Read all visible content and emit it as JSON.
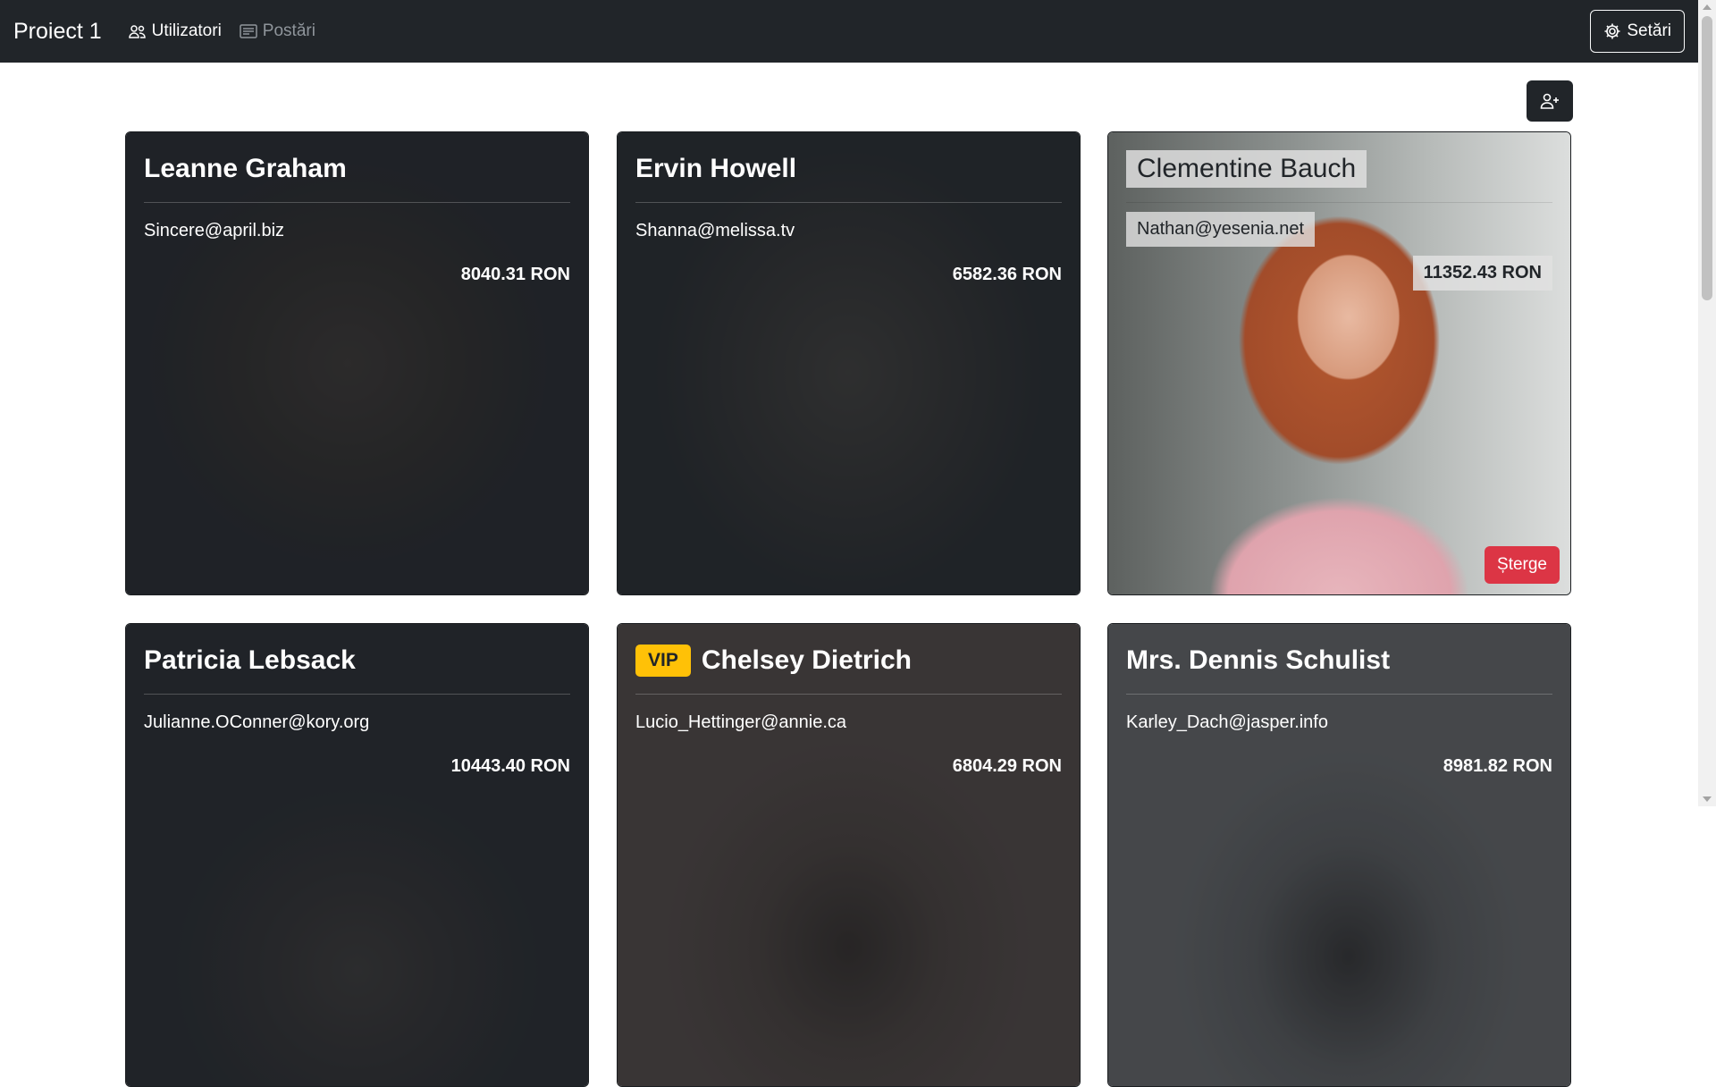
{
  "navbar": {
    "brand": "Proiect 1",
    "links": [
      {
        "label": "Utilizatori",
        "icon": "users-icon",
        "active": true
      },
      {
        "label": "Postări",
        "icon": "posts-icon",
        "active": false
      }
    ],
    "settings_label": "Setări"
  },
  "toolbar": {
    "add_user_icon": "person-plus-icon"
  },
  "colors": {
    "navbar_bg": "#212529",
    "vip_badge": "#ffc107",
    "delete_button": "#dc3545"
  },
  "users": [
    {
      "name": "Leanne Graham",
      "email": "Sincere@april.biz",
      "salary": "8040.31 RON"
    },
    {
      "name": "Ervin Howell",
      "email": "Shanna@melissa.tv",
      "salary": "6582.36 RON"
    },
    {
      "name": "Clementine Bauch",
      "email": "Nathan@yesenia.net",
      "salary": "11352.43 RON",
      "delete_label": "Șterge"
    },
    {
      "name": "Patricia Lebsack",
      "email": "Julianne.OConner@kory.org",
      "salary": "10443.40 RON"
    },
    {
      "name": "Chelsey Dietrich",
      "email": "Lucio_Hettinger@annie.ca",
      "salary": "6804.29 RON",
      "badge": "VIP"
    },
    {
      "name": "Mrs. Dennis Schulist",
      "email": "Karley_Dach@jasper.info",
      "salary": "8981.82 RON"
    }
  ]
}
